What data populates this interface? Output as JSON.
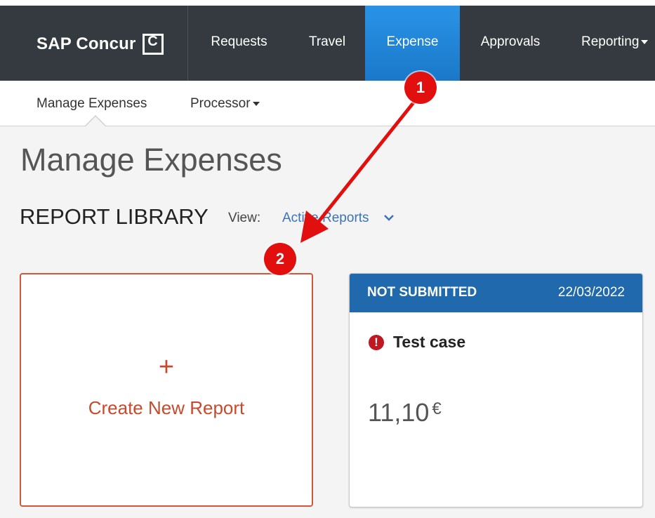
{
  "brand": {
    "name": "SAP Concur",
    "logo_glyph": "C"
  },
  "topnav": {
    "items": [
      {
        "label": "Requests"
      },
      {
        "label": "Travel"
      },
      {
        "label": "Expense",
        "active": true
      },
      {
        "label": "Approvals"
      },
      {
        "label": "Reporting",
        "has_dropdown": true
      }
    ]
  },
  "subnav": {
    "items": [
      {
        "label": "Manage Expenses",
        "selected": true
      },
      {
        "label": "Processor",
        "has_dropdown": true
      }
    ]
  },
  "page": {
    "title": "Manage Expenses",
    "section_title": "REPORT LIBRARY",
    "view_label": "View:",
    "view_value": "Active Reports"
  },
  "create_card": {
    "plus": "+",
    "label": "Create New Report"
  },
  "report_card": {
    "status": "NOT SUBMITTED",
    "date": "22/03/2022",
    "alert_icon": "exclamation-circle-icon",
    "name": "Test case",
    "amount": "11,10",
    "currency": "€"
  },
  "annotations": {
    "badge_1": "1",
    "badge_2": "2"
  },
  "colors": {
    "topbar": "#353a40",
    "active_tab": "#1f7fd4",
    "report_header": "#1f69ac",
    "create_accent": "#d4553a",
    "annotation": "#e20f0f",
    "alert": "#c01722"
  }
}
